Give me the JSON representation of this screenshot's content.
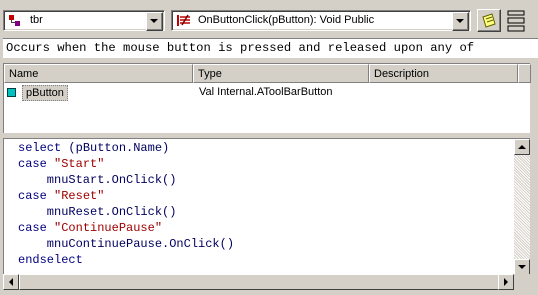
{
  "toolbar": {
    "object_combo": {
      "value": "tbr",
      "icon": "toolbar-object-icon"
    },
    "method_combo": {
      "value": "OnButtonClick(pButton): Void Public",
      "icon": "event-method-icon"
    },
    "notes_icon": "notes-icon",
    "panel_icon": "panel-layout-icon"
  },
  "description": "Occurs when the mouse button is pressed and released upon any of",
  "params_grid": {
    "columns": [
      "Name",
      "Type",
      "Description"
    ],
    "rows": [
      {
        "name": "pButton",
        "type": "Val Internal.AToolBarButton",
        "description": ""
      }
    ]
  },
  "code": {
    "l1a": "select",
    "l1b": " (pButton.Name)",
    "l2a": "case",
    "l2b": " \"Start\"",
    "l3": "    mnuStart.OnClick()",
    "l4a": "case",
    "l4b": " \"Reset\"",
    "l5": "    mnuReset.OnClick()",
    "l6a": "case",
    "l6b": " \"ContinuePause\"",
    "l7": "    mnuContinuePause.OnClick()",
    "l8": "endselect"
  },
  "colors": {
    "keyword": "#000080",
    "string": "#a00000",
    "face": "#d4d0c8"
  }
}
